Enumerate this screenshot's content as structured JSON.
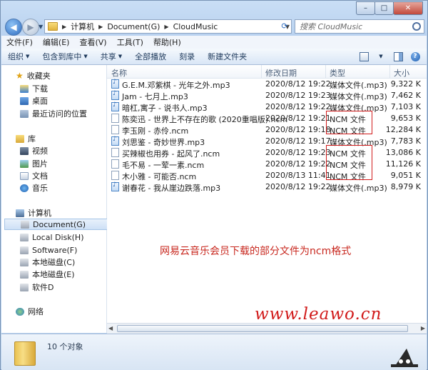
{
  "window": {
    "controls": {
      "minimize": "–",
      "maximize": "□",
      "close": "✕"
    }
  },
  "address": {
    "crumbs": [
      "计算机",
      "Document(G)",
      "CloudMusic"
    ],
    "search_placeholder": "搜索 CloudMusic"
  },
  "menu": [
    "文件(F)",
    "编辑(E)",
    "查看(V)",
    "工具(T)",
    "帮助(H)"
  ],
  "toolbar": {
    "organize": "组织",
    "include_library": "包含到库中",
    "share": "共享",
    "play_all": "全部播放",
    "burn": "刻录",
    "new_folder": "新建文件夹"
  },
  "nav": {
    "favorites": "收藏夹",
    "downloads": "下载",
    "desktop": "桌面",
    "recent": "最近访问的位置",
    "libraries": "库",
    "videos": "视频",
    "pictures": "图片",
    "documents": "文档",
    "music": "音乐",
    "computer": "计算机",
    "drives": [
      "Document(G)",
      "Local Disk(H)",
      "Software(F)",
      "本地磁盘(C)",
      "本地磁盘(E)",
      "软件D"
    ],
    "network": "网络"
  },
  "columns": {
    "name": "名称",
    "date": "修改日期",
    "type": "类型",
    "size": "大小"
  },
  "files": [
    {
      "name": "G.E.M.邓紫棋 - 光年之外.mp3",
      "date": "2020/8/12 19:22",
      "type": "媒体文件(.mp3)",
      "size": "9,322 K",
      "kind": "mp3"
    },
    {
      "name": "Jam - 七月上.mp3",
      "date": "2020/8/12 19:23",
      "type": "媒体文件(.mp3)",
      "size": "7,462 K",
      "kind": "mp3"
    },
    {
      "name": "暗杠,寓子 - 说书人.mp3",
      "date": "2020/8/12 19:22",
      "type": "媒体文件(.mp3)",
      "size": "7,103 K",
      "kind": "mp3"
    },
    {
      "name": "陈奕迅 - 世界上不存在的歌 (2020重唱版).ncm",
      "date": "2020/8/12 19:21",
      "type": "NCM 文件",
      "size": "9,653 K",
      "kind": "ncm"
    },
    {
      "name": "李玉刚 - 赤伶.ncm",
      "date": "2020/8/12 19:18",
      "type": "NCM 文件",
      "size": "12,284 K",
      "kind": "ncm"
    },
    {
      "name": "刘思鉴 - 奇妙世界.mp3",
      "date": "2020/8/12 19:17",
      "type": "媒体文件(.mp3)",
      "size": "7,783 K",
      "kind": "mp3"
    },
    {
      "name": "买辣椒也用券 - 起风了.ncm",
      "date": "2020/8/12 19:23",
      "type": "NCM 文件",
      "size": "13,086 K",
      "kind": "ncm"
    },
    {
      "name": "毛不易 - 一荤一素.ncm",
      "date": "2020/8/12 19:22",
      "type": "NCM 文件",
      "size": "11,126 K",
      "kind": "ncm"
    },
    {
      "name": "木小雅 - 可能否.ncm",
      "date": "2020/8/13 11:41",
      "type": "NCM 文件",
      "size": "9,051 K",
      "kind": "ncm"
    },
    {
      "name": "谢春花 - 我从崖边跌落.mp3",
      "date": "2020/8/12 19:22",
      "type": "媒体文件(.mp3)",
      "size": "8,979 K",
      "kind": "mp3"
    }
  ],
  "annotation": "网易云音乐会员下载的部分文件为ncm格式",
  "watermark": "www.leawo.cn",
  "status": {
    "count": "10 个对象"
  }
}
